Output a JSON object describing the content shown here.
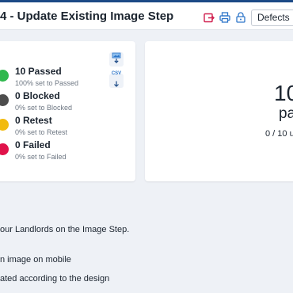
{
  "header": {
    "title": "4 - Update Existing Image Step",
    "defects_label": "Defects",
    "icons": [
      "export-icon",
      "print-icon",
      "lock-icon",
      "chevron-down-icon"
    ]
  },
  "stats": [
    {
      "label": "10 Passed",
      "sub": "100% set to Passed",
      "color": "#2fb84d"
    },
    {
      "label": "0 Blocked",
      "sub": "0% set to Blocked",
      "color": "#4d4d4d"
    },
    {
      "label": "0 Retest",
      "sub": "0% set to Retest",
      "color": "#f2bb0f"
    },
    {
      "label": "0 Failed",
      "sub": "0% set to Failed",
      "color": "#e0124a"
    }
  ],
  "export": {
    "csv_label": "CSV",
    "icons": [
      "image-download-icon",
      "csv-download-icon"
    ]
  },
  "summary": {
    "big_number": "10",
    "big_label": "pa",
    "ratio": "0 / 10 ur"
  },
  "description": {
    "line1": "our Landlords on the Image Step.",
    "line2": "n image on mobile",
    "line3": "ated according to the design"
  },
  "colors": {
    "accent": "#1c4a86",
    "icon": "#2e76c9",
    "danger_icon": "#d0204f"
  }
}
